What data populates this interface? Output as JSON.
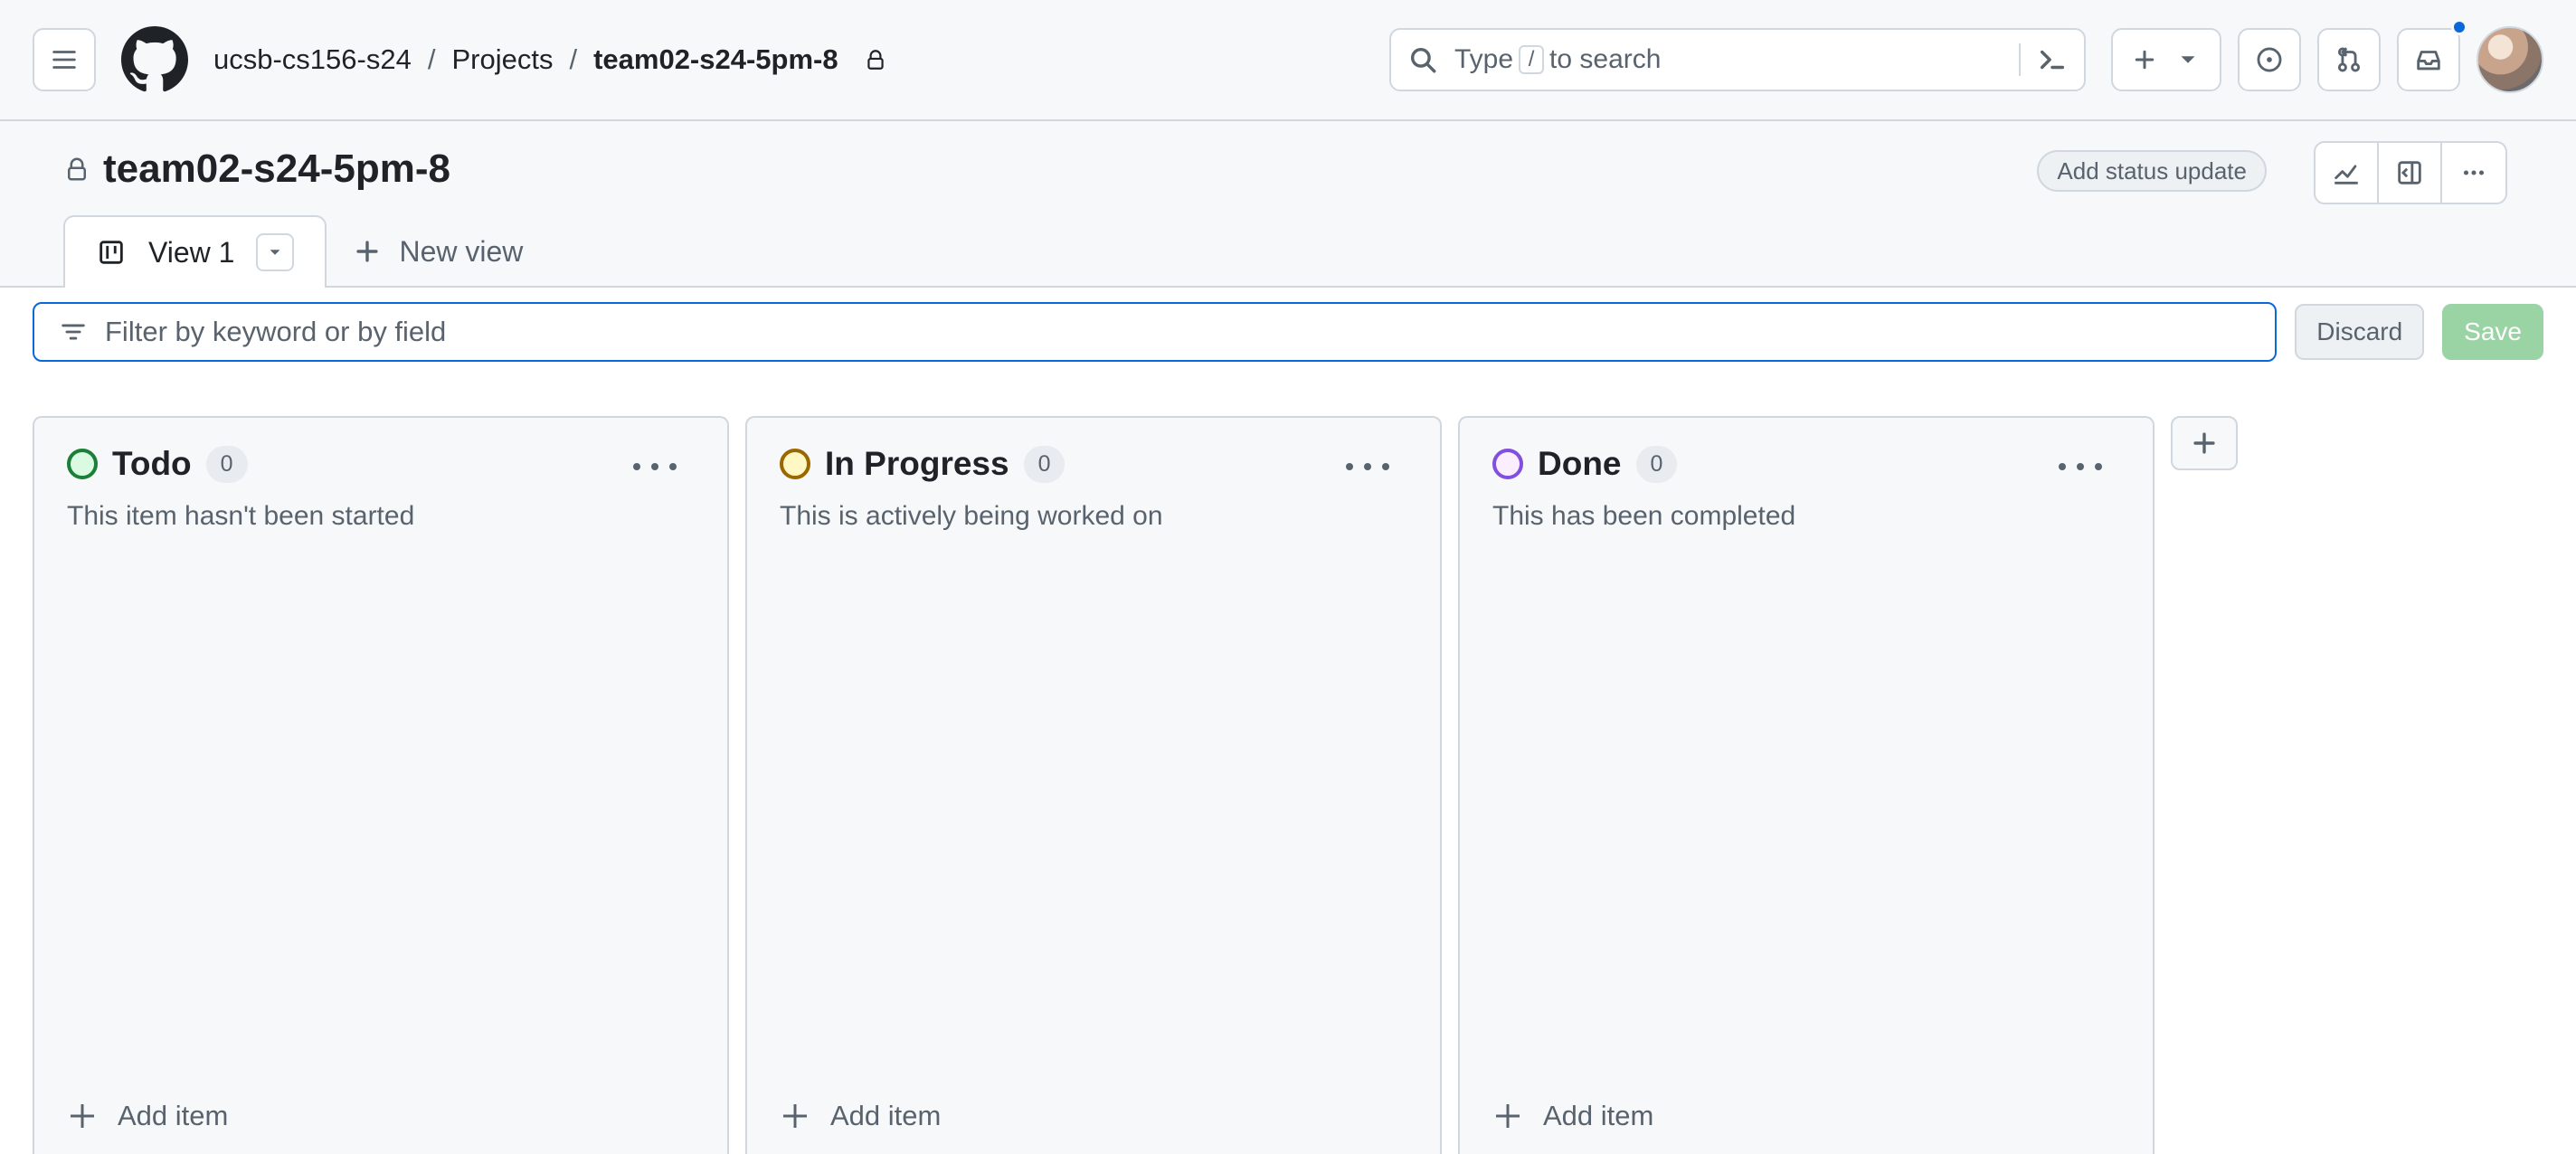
{
  "topbar": {
    "org": "ucsb-cs156-s24",
    "projects": "Projects",
    "project": "team02-s24-5pm-8",
    "search": {
      "prefix": "Type",
      "kbd": "/",
      "suffix": "to search"
    },
    "icons": [
      "hamburger-icon",
      "github-logo-icon",
      "lock-icon",
      "search-icon",
      "terminal-icon",
      "plus-icon",
      "chevron-down-icon",
      "issues-icon",
      "pull-requests-icon",
      "inbox-icon",
      "avatar"
    ]
  },
  "project": {
    "title": "team02-s24-5pm-8",
    "status_button": "Add status update",
    "tabs": [
      {
        "label": "View 1"
      }
    ],
    "new_view": "New view"
  },
  "filter": {
    "placeholder": "Filter by keyword or by field",
    "discard": "Discard",
    "save": "Save"
  },
  "board": {
    "columns": [
      {
        "name": "Todo",
        "count": "0",
        "description": "This item hasn't been started",
        "color": "#1a7f37",
        "fill": "#dafbe1"
      },
      {
        "name": "In Progress",
        "count": "0",
        "description": "This is actively being worked on",
        "color": "#9a6700",
        "fill": "#fff8c5"
      },
      {
        "name": "Done",
        "count": "0",
        "description": "This has been completed",
        "color": "#8250df",
        "fill": "#fbefff"
      }
    ],
    "add_item": "Add item"
  },
  "colors": {
    "accent": "#0969da",
    "save_disabled": "#9ad3a4",
    "notification_dot": "#0969da"
  }
}
